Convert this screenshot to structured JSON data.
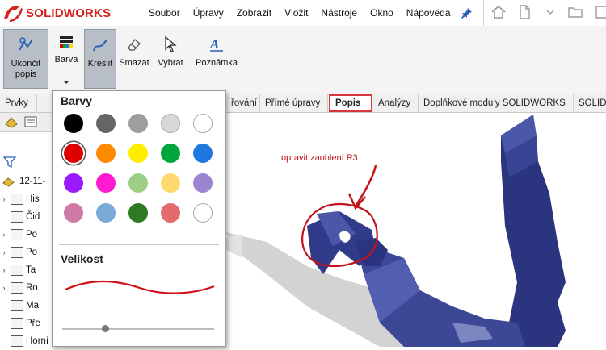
{
  "app": {
    "logo_text": "SOLIDWORKS"
  },
  "menu": [
    "Soubor",
    "Úpravy",
    "Zobrazit",
    "Vložit",
    "Nástroje",
    "Okno",
    "Nápověda"
  ],
  "ribbon": {
    "finish": "Ukončit popis",
    "color": "Barva",
    "draw": "Kreslit",
    "erase": "Smazat",
    "select": "Vybrat",
    "note": "Poznámka"
  },
  "tabs": [
    "Prvky",
    "řování",
    "Přímé úpravy",
    "Popis",
    "Analýzy",
    "Doplňkové moduly SOLIDWORKS",
    "SOLID"
  ],
  "tree": {
    "root": "12-11-",
    "items": [
      "His",
      "Čid",
      "Po",
      "Po",
      "Ta",
      "Ro",
      "Ma",
      "Pře",
      "Horní rovina"
    ]
  },
  "popup": {
    "colors_title": "Barvy",
    "size_title": "Velikost",
    "swatches": [
      "#000000",
      "#666666",
      "#9e9e9e",
      "#d8d8d8",
      "#ffffff",
      "#e00000",
      "#ff8a00",
      "#ffee00",
      "#00a63a",
      "#1f78e0",
      "#9a1aff",
      "#ff1ad1",
      "#9ccf85",
      "#ffd86e",
      "#9b85d1",
      "#cf7aa6",
      "#79a8d9",
      "#2e7a22",
      "#e36b6b",
      "#ffffff"
    ],
    "selected_index": 5,
    "stroke_color": "#d0101a",
    "size_level": 0.26
  },
  "annotation": {
    "text": "opravit zaoblení R3",
    "color": "#c4121b"
  }
}
